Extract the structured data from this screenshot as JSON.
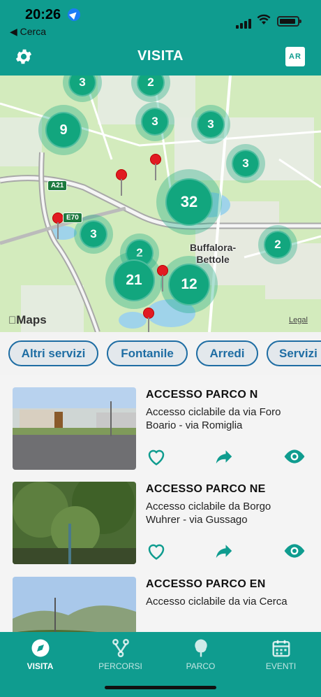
{
  "status": {
    "time": "20:26",
    "back_label": "◀ Cerca"
  },
  "header": {
    "title": "VISITA",
    "ar_label": "AR"
  },
  "map": {
    "clusters": [
      "3",
      "2",
      "9",
      "3",
      "3",
      "3",
      "32",
      "3",
      "2",
      "2",
      "21",
      "12"
    ],
    "place_label": "Buffalora-\nBettole",
    "road_badges": [
      "A21",
      "E70"
    ],
    "logo_text": "Maps",
    "legal_label": "Legal"
  },
  "filters": [
    "Altri servizi",
    "Fontanile",
    "Arredi",
    "Servizi"
  ],
  "places": [
    {
      "title": "ACCESSO PARCO N",
      "description": "Accesso ciclabile da via Foro Boario - via Romiglia"
    },
    {
      "title": "ACCESSO PARCO NE",
      "description": "Accesso ciclabile da Borgo Wuhrer - via Gussago"
    },
    {
      "title": "ACCESSO PARCO EN",
      "description": "Accesso ciclabile da via Cerca"
    }
  ],
  "tabs": [
    {
      "label": "VISITA",
      "icon": "compass-icon",
      "active": true
    },
    {
      "label": "PERCORSI",
      "icon": "route-icon",
      "active": false
    },
    {
      "label": "PARCO",
      "icon": "tree-icon",
      "active": false
    },
    {
      "label": "EVENTI",
      "icon": "calendar-icon",
      "active": false
    }
  ],
  "colors": {
    "primary": "#0f9c8f",
    "chip": "#1e6da3",
    "cluster": "#12a67e",
    "pin": "#e11b22"
  }
}
